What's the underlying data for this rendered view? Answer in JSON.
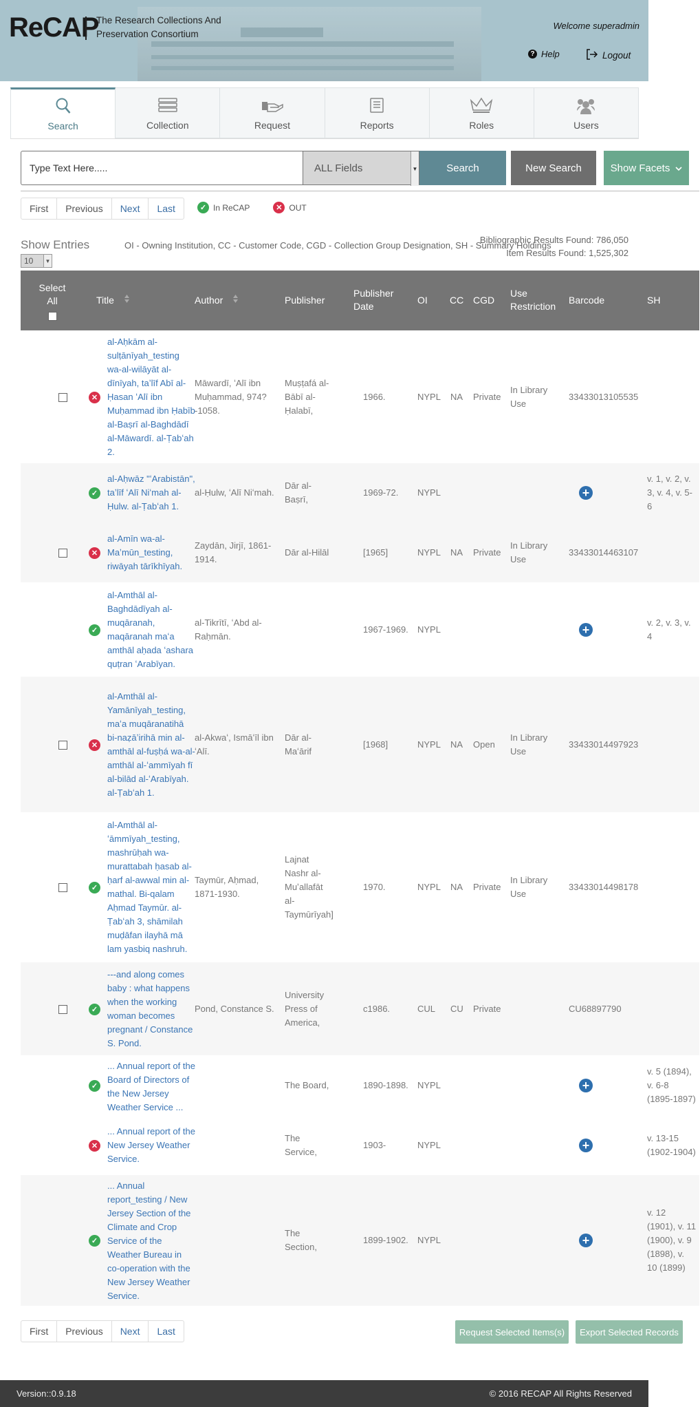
{
  "header": {
    "logo": "ReCAP",
    "tagline_line1": "The Research Collections And",
    "tagline_line2": "Preservation Consortium",
    "welcome": "Welcome superadmin",
    "help": "Help",
    "logout": "Logout"
  },
  "tabs": [
    {
      "label": "Search",
      "icon": "search-icon",
      "active": true
    },
    {
      "label": "Collection",
      "icon": "books-icon"
    },
    {
      "label": "Request",
      "icon": "hand-request-icon"
    },
    {
      "label": "Reports",
      "icon": "reports-icon"
    },
    {
      "label": "Roles",
      "icon": "crown-icon"
    },
    {
      "label": "Users",
      "icon": "users-icon"
    }
  ],
  "search": {
    "placeholder": "Type Text Here.....",
    "field": "ALL Fields",
    "search_label": "Search",
    "new_search_label": "New Search",
    "show_facets_label": "Show Facets"
  },
  "pager": {
    "first": "First",
    "previous": "Previous",
    "next": "Next",
    "last": "Last"
  },
  "legend": {
    "in": "In ReCAP",
    "out": "OUT"
  },
  "entries": {
    "label": "Show Entries",
    "value": "10"
  },
  "abbreviations": "OI - Owning Institution, CC - Customer Code, CGD - Collection Group Designation, SH - Summary Holdings",
  "counts": {
    "bib": "Bibliographic Results Found: 786,050",
    "item": "Item Results Found: 1,525,302"
  },
  "columns": {
    "select_all": "Select All",
    "title": "Title",
    "author": "Author",
    "publisher": "Publisher",
    "publisher_date": "Publisher Date",
    "oi": "OI",
    "cc": "CC",
    "cgd": "CGD",
    "use_restriction": "Use Restriction",
    "barcode": "Barcode",
    "sh": "SH"
  },
  "rows": [
    {
      "status": "out",
      "title": "al-Aḥkām al-sulṭānīyah_testing wa-al-wilāyāt al-dīnīyah, taʼlīf Abī al-Ḥasan ʻAlī ibn Muḥammad ibn Ḥabīb al-Baṣrī al-Baghdādī al-Māwardī. al-Ṭabʻah 2.",
      "author": "Māwardī, ʻAlī ibn Muḥammad, 974?-1058.",
      "publisher": "Muṣṭafá al-Bābī al-Ḥalabī,",
      "date": "1966.",
      "oi": "NYPL",
      "cc": "NA",
      "cgd": "Private",
      "use": "In Library Use",
      "barcode": "33433013105535",
      "sh": "",
      "checkbox": true,
      "plus": false
    },
    {
      "status": "in",
      "title": "al-Aḥwāz \"ʻArabistān\", taʼlīf ʻAlī Niʻmah al-Ḥulw. al-Ṭabʻah 1.",
      "author": "al-Ḥulw, ʻAlī Niʻmah.",
      "publisher": "Dār al-Baṣrī,",
      "date": "1969-72.",
      "oi": "NYPL",
      "cc": "",
      "cgd": "",
      "use": "",
      "barcode": "",
      "sh": "v. 1, v. 2, v. 3, v. 4, v. 5-6",
      "checkbox": false,
      "plus": true
    },
    {
      "status": "out",
      "title": "al-Amīn wa-al-Maʼmūn_testing, riwāyah tārīkhīyah.",
      "author": "Zaydān, Jirjī, 1861-1914.",
      "publisher": "Dār al-Hilāl",
      "date": "[1965]",
      "oi": "NYPL",
      "cc": "NA",
      "cgd": "Private",
      "use": "In Library Use",
      "barcode": "33433014463107",
      "sh": "",
      "checkbox": true,
      "plus": false
    },
    {
      "status": "in",
      "title": "al-Amthāl al-Baghdādīyah al-muqāranah, maqāranah maʻa amthāl aḥada ʻashara quṭran ʻArabīyan.",
      "author": "al-Tikrītī, ʻAbd al-Raḥmān.",
      "publisher": "",
      "date": "1967-1969.",
      "oi": "NYPL",
      "cc": "",
      "cgd": "",
      "use": "",
      "barcode": "",
      "sh": "v. 2, v. 3, v. 4",
      "checkbox": false,
      "plus": true
    },
    {
      "status": "out",
      "title": "al-Amthāl al-Yamānīyah_testing, maʻa muqāranatihā bi-naẓāʼirihā min al-amthāl al-fuṣḥá wa-al-amthāl al-ʻammīyah fī al-bilād al-ʻArabīyah. al-Ṭabʻah 1.",
      "author": "al-Akwaʻ, Ismāʻīl ibn ʻAlī.",
      "publisher": "Dār al-Maʻārif",
      "date": "[1968]",
      "oi": "NYPL",
      "cc": "NA",
      "cgd": "Open",
      "use": "In Library Use",
      "barcode": "33433014497923",
      "sh": "",
      "checkbox": true,
      "plus": false
    },
    {
      "status": "in",
      "title": "al-Amthāl al-ʻāmmīyah_testing, mashrūḥah wa-murattabah ḥasab al-ḥarf al-awwal min al-mathal. Bi-qalam Aḥmad Taymūr. al-Ṭabʻah 3, shāmilah muḍāfan ilayhā mā lam yasbiq nashruh.",
      "author": "Taymūr, Aḥmad, 1871-1930.",
      "publisher": "Lajnat Nashr al-Muʼallafāt al-Taymūrīyah]",
      "date": "1970.",
      "oi": "NYPL",
      "cc": "NA",
      "cgd": "Private",
      "use": "In Library Use",
      "barcode": "33433014498178",
      "sh": "",
      "checkbox": true,
      "plus": false
    },
    {
      "status": "in",
      "title": "---and along comes baby : what happens when the working woman becomes pregnant / Constance S. Pond.",
      "author": "Pond, Constance S.",
      "publisher": "University Press of America,",
      "date": "c1986.",
      "oi": "CUL",
      "cc": "CU",
      "cgd": "Private",
      "use": "",
      "barcode": "CU68897790",
      "sh": "",
      "checkbox": true,
      "plus": false
    },
    {
      "status": "in",
      "title": "... Annual report of the Board of Directors of the New Jersey Weather Service ...",
      "author": "",
      "publisher": "The Board,",
      "date": "1890-1898.",
      "oi": "NYPL",
      "cc": "",
      "cgd": "",
      "use": "",
      "barcode": "",
      "sh": "v. 5 (1894), v. 6-8 (1895-1897)",
      "checkbox": false,
      "plus": true
    },
    {
      "status": "out",
      "title": "... Annual report of the New Jersey Weather Service.",
      "author": "",
      "publisher": "The Service,",
      "date": "1903-",
      "oi": "NYPL",
      "cc": "",
      "cgd": "",
      "use": "",
      "barcode": "",
      "sh": "v. 13-15 (1902-1904)",
      "checkbox": false,
      "plus": true
    },
    {
      "status": "in",
      "title": "... Annual report_testing / New Jersey Section of the Climate and Crop Service of the Weather Bureau in co-operation with the New Jersey Weather Service.",
      "author": "",
      "publisher": "The Section,",
      "date": "1899-1902.",
      "oi": "NYPL",
      "cc": "",
      "cgd": "",
      "use": "",
      "barcode": "",
      "sh": "v. 12 (1901), v. 11 (1900), v. 9 (1898), v. 10 (1899)",
      "checkbox": false,
      "plus": true
    }
  ],
  "bottom": {
    "request_selected": "Request Selected Items(s)",
    "export_selected": "Export Selected Records"
  },
  "footer": {
    "version": "Version::0.9.18",
    "copyright": "© 2016 RECAP All Rights Reserved"
  },
  "colors": {
    "header_bg": "#a8c3cc",
    "search_btn": "#5f8994",
    "facets_btn": "#6aa88d",
    "table_head": "#757575",
    "in_status": "#3aaa55",
    "out_status": "#d9304a",
    "link": "#3a75b5"
  }
}
